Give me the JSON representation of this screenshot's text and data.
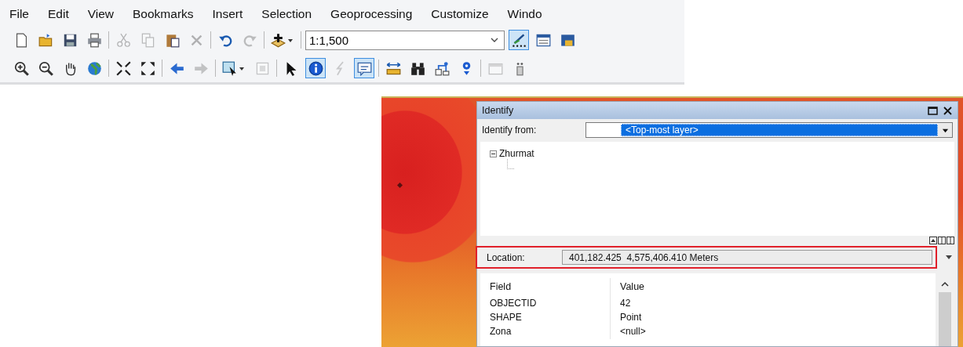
{
  "menu_bar": {
    "items": [
      "File",
      "Edit",
      "View",
      "Bookmarks",
      "Insert",
      "Selection",
      "Geoprocessing",
      "Customize",
      "Windo"
    ]
  },
  "toolbar_1": {
    "items": [
      {
        "kind": "button",
        "disabled": false,
        "selected": false
      },
      {
        "kind": "button",
        "disabled": false,
        "selected": false
      },
      {
        "kind": "button",
        "disabled": false,
        "selected": false
      },
      {
        "kind": "button",
        "disabled": false,
        "selected": false
      },
      {
        "kind": "separator"
      },
      {
        "kind": "button",
        "disabled": true,
        "selected": false
      },
      {
        "kind": "button",
        "disabled": true,
        "selected": false
      },
      {
        "kind": "button",
        "disabled": false,
        "selected": false
      },
      {
        "kind": "button",
        "disabled": true,
        "selected": false
      },
      {
        "kind": "separator"
      },
      {
        "kind": "button",
        "disabled": false,
        "selected": false
      },
      {
        "kind": "button",
        "disabled": true,
        "selected": false
      },
      {
        "kind": "separator"
      },
      {
        "kind": "dropdown",
        "disabled": false,
        "selected": false
      },
      {
        "kind": "separator"
      },
      {
        "kind": "combo",
        "value": "1:1,500"
      },
      {
        "kind": "button",
        "disabled": false,
        "selected": true
      },
      {
        "kind": "button",
        "disabled": false,
        "selected": false
      },
      {
        "kind": "button",
        "disabled": false,
        "selected": false
      }
    ]
  },
  "toolbar_2": {
    "items": [
      {
        "kind": "button",
        "disabled": false,
        "selected": false
      },
      {
        "kind": "button",
        "disabled": false,
        "selected": false
      },
      {
        "kind": "button",
        "disabled": false,
        "selected": false
      },
      {
        "kind": "button",
        "disabled": false,
        "selected": false
      },
      {
        "kind": "separator"
      },
      {
        "kind": "button",
        "disabled": false,
        "selected": false
      },
      {
        "kind": "button",
        "disabled": false,
        "selected": false
      },
      {
        "kind": "separator"
      },
      {
        "kind": "button",
        "disabled": false,
        "selected": false
      },
      {
        "kind": "button",
        "disabled": true,
        "selected": false
      },
      {
        "kind": "separator"
      },
      {
        "kind": "dropdown",
        "disabled": false,
        "selected": false
      },
      {
        "kind": "button",
        "disabled": true,
        "selected": false
      },
      {
        "kind": "separator"
      },
      {
        "kind": "button",
        "disabled": false,
        "selected": false
      },
      {
        "kind": "button",
        "disabled": false,
        "selected": true
      },
      {
        "kind": "button",
        "disabled": true,
        "selected": false
      },
      {
        "kind": "button",
        "disabled": false,
        "selected": true
      },
      {
        "kind": "separator"
      },
      {
        "kind": "button",
        "disabled": false,
        "selected": false
      },
      {
        "kind": "button",
        "disabled": false,
        "selected": false
      },
      {
        "kind": "button",
        "disabled": false,
        "selected": false
      },
      {
        "kind": "button",
        "disabled": false,
        "selected": false
      },
      {
        "kind": "separator"
      },
      {
        "kind": "button",
        "disabled": true,
        "selected": false
      },
      {
        "kind": "button",
        "disabled": false,
        "selected": false
      }
    ]
  },
  "identify_window": {
    "title": "Identify",
    "identify_from": {
      "label": "Identify from:",
      "value": "<Top-most layer>"
    },
    "tree": [
      {
        "label": "Zhurmat",
        "expanded": true
      }
    ],
    "location": {
      "label": "Location:",
      "value": "401,182.425  4,575,406.410 Meters",
      "highlighted": true
    },
    "table": {
      "columns": [
        "Field",
        "Value"
      ],
      "rows": [
        [
          "OBJECTID",
          "42"
        ],
        [
          "SHAPE",
          "Point"
        ],
        [
          "Zona",
          "<null>"
        ]
      ]
    }
  }
}
